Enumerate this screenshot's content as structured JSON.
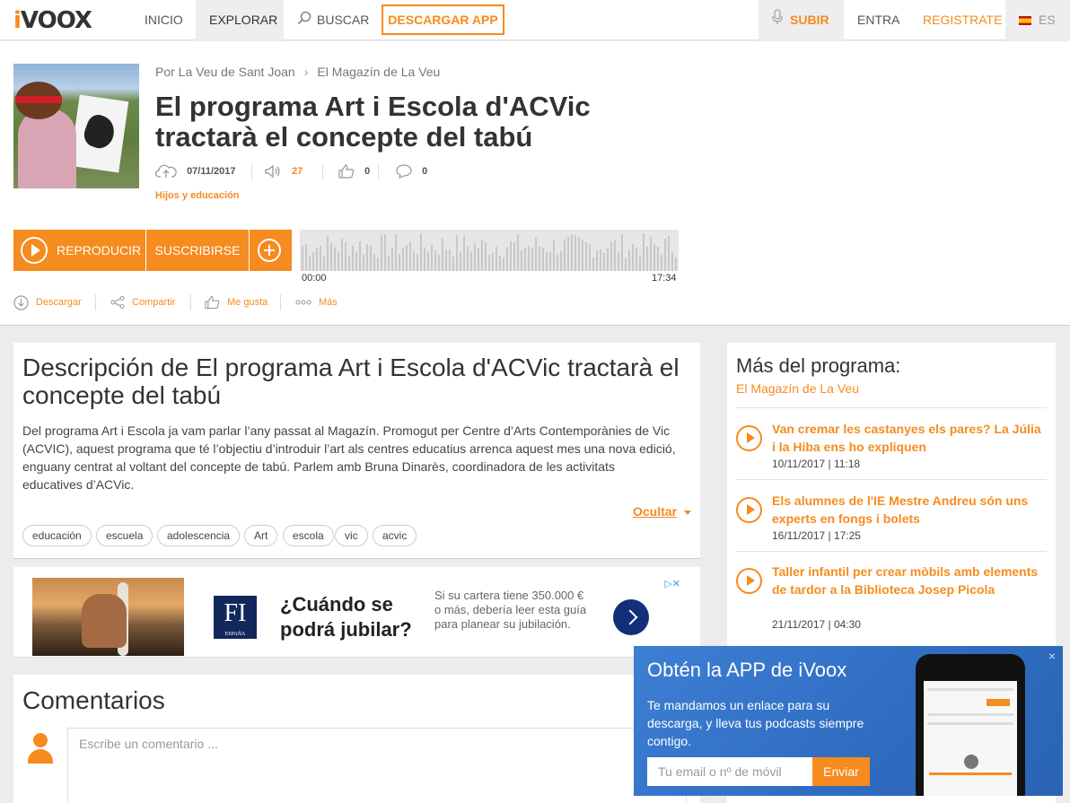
{
  "nav": {
    "logo_i": "i",
    "logo_rest": "VOOX",
    "inicio": "INICIO",
    "explorar": "EXPLORAR",
    "buscar": "BUSCAR",
    "download_app": "DESCARGAR APP",
    "subir": "SUBIR",
    "entra": "ENTRA",
    "registrate": "REGISTRATE",
    "lang": "ES"
  },
  "episode": {
    "breadcrumb_owner": "Por La Veu de Sant Joan",
    "breadcrumb_program": "El Magazín de La Veu",
    "title": "El programa Art i Escola d'ACVic tractarà el concepte del tabú",
    "date": "07/11/2017",
    "plays": "27",
    "likes": "0",
    "comments": "0",
    "category": "Hijos y educación"
  },
  "player": {
    "play_label": "REPRODUCIR",
    "subscribe_label": "SUSCRIBIRSE",
    "time_start": "00:00",
    "time_end": "17:34"
  },
  "actions": {
    "download": "Descargar",
    "share": "Compartir",
    "like": "Me gusta",
    "more": "Más"
  },
  "description": {
    "heading": "Descripción de El programa Art i Escola d'ACVic tractarà el concepte del tabú",
    "text": "Del programa Art i Escola ja vam parlar l’any passat al Magazín. Promogut per Centre d’Arts Contemporànies de Vic (ACVIC), aquest programa que té l’objectiu d’introduir l’art als centres educatius arrenca aquest mes una nova edició, enguany centrat al voltant del concepte de tabú. Parlem amb Bruna Dinarès, coordinadora de les activitats educatives d’ACVic.",
    "hide_label": "Ocultar",
    "tags": [
      "educación",
      "escuela",
      "adolescencia",
      "Art",
      "escola",
      "vic",
      "acvic"
    ]
  },
  "ad": {
    "logo_text": "FI",
    "logo_sub": "ESPAÑA",
    "headline": "¿Cuándo se podrá jubilar?",
    "body": "Si su cartera tiene 350.000 € o más, debería leer esta guía para planear su jubilación."
  },
  "comments": {
    "heading": "Comentarios",
    "placeholder": "Escribe un comentario ..."
  },
  "sidebar": {
    "heading": "Más del programa:",
    "program": "El Magazín de La Veu",
    "items": [
      {
        "title": "Van cremar les castanyes els pares? La Júlia i la Hiba ens ho expliquen",
        "date": "10/11/2017 | 11:18"
      },
      {
        "title": "Els alumnes de l'IE Mestre Andreu són uns experts en fongs i bolets",
        "date": "16/11/2017 | 17:25"
      },
      {
        "title": "Taller infantil per crear mòbils amb elements de tardor a la Biblioteca Josep Picola",
        "date": "21/11/2017 | 04:30"
      }
    ]
  },
  "popup": {
    "title": "Obtén la APP de iVoox",
    "text": "Te mandamos un enlace para su descarga, y lleva tus podcasts siempre contigo.",
    "input_placeholder": "Tu email o nº de móvil",
    "send_label": "Enviar",
    "close": "×"
  },
  "colors": {
    "accent": "#f68b1f",
    "popup_blue": "#3d7fd4",
    "text": "#333333"
  }
}
